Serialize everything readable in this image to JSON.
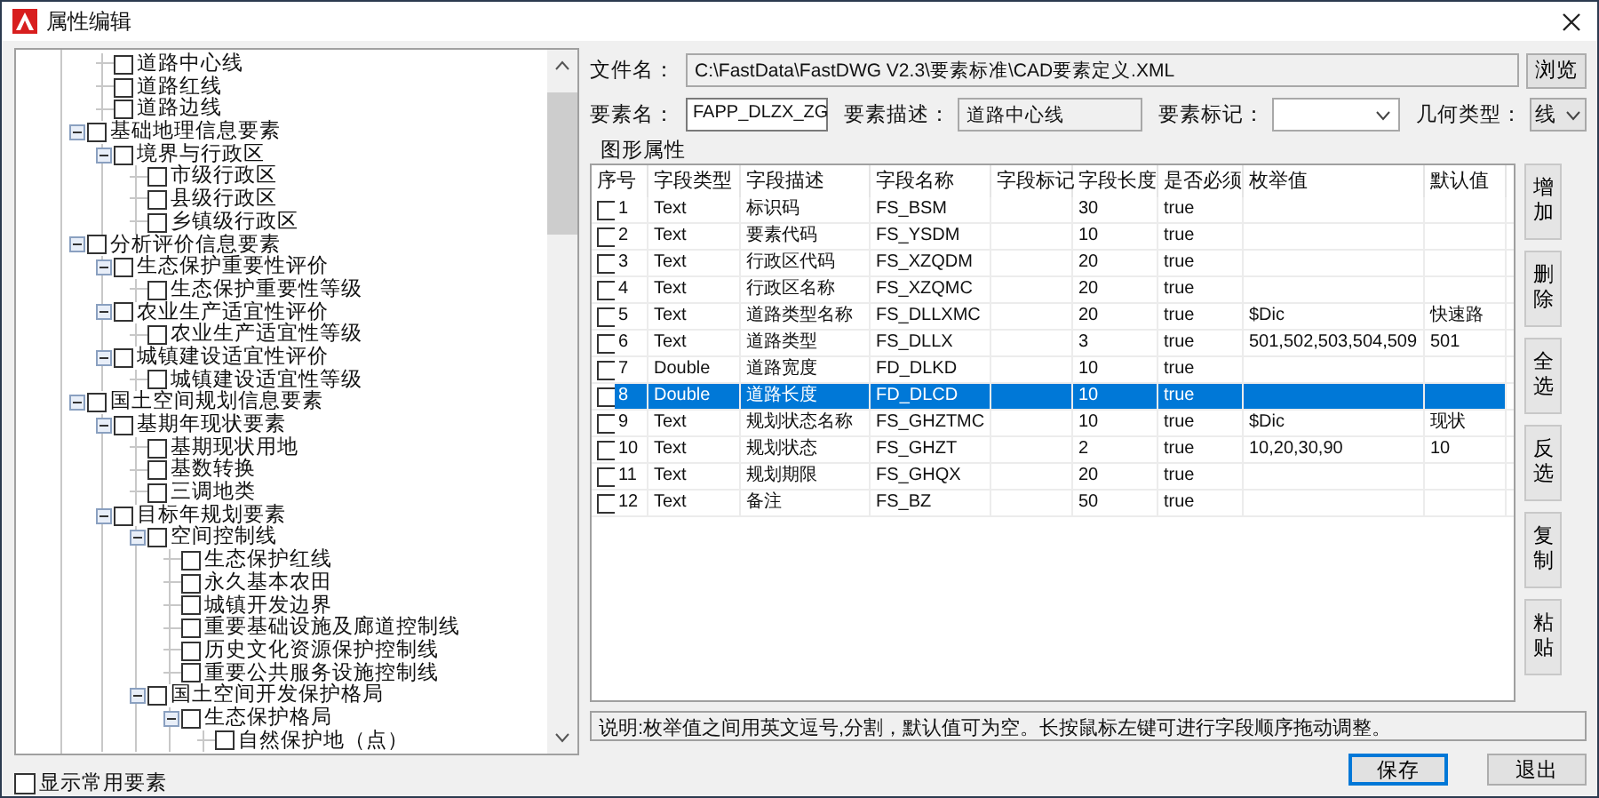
{
  "window": {
    "title": "属性编辑"
  },
  "tree": {
    "items": [
      {
        "children": [
          {
            "label": "道路中心线",
            "checked": false
          },
          {
            "label": "道路红线",
            "checked": false
          },
          {
            "label": "道路边线",
            "checked": false
          }
        ]
      },
      {
        "label": "基础地理信息要素",
        "checked": false,
        "expanded": true,
        "children": [
          {
            "label": "境界与行政区",
            "checked": false,
            "expanded": true,
            "children": [
              {
                "label": "市级行政区",
                "checked": false
              },
              {
                "label": "县级行政区",
                "checked": false
              },
              {
                "label": "乡镇级行政区",
                "checked": false
              }
            ]
          }
        ]
      },
      {
        "label": "分析评价信息要素",
        "checked": false,
        "expanded": true,
        "children": [
          {
            "label": "生态保护重要性评价",
            "checked": false,
            "expanded": true,
            "children": [
              {
                "label": "生态保护重要性等级",
                "checked": false
              }
            ]
          },
          {
            "label": "农业生产适宜性评价",
            "checked": false,
            "expanded": true,
            "children": [
              {
                "label": "农业生产适宜性等级",
                "checked": false
              }
            ]
          },
          {
            "label": "城镇建设适宜性评价",
            "checked": false,
            "expanded": true,
            "children": [
              {
                "label": "城镇建设适宜性等级",
                "checked": false
              }
            ]
          }
        ]
      },
      {
        "label": "国土空间规划信息要素",
        "checked": false,
        "expanded": true,
        "children": [
          {
            "label": "基期年现状要素",
            "checked": false,
            "expanded": true,
            "children": [
              {
                "label": "基期现状用地",
                "checked": false
              },
              {
                "label": "基数转换",
                "checked": false
              },
              {
                "label": "三调地类",
                "checked": false
              }
            ]
          },
          {
            "label": "目标年规划要素",
            "checked": false,
            "expanded": true,
            "children": [
              {
                "label": "空间控制线",
                "checked": false,
                "expanded": true,
                "children": [
                  {
                    "label": "生态保护红线",
                    "checked": false
                  },
                  {
                    "label": "永久基本农田",
                    "checked": false
                  },
                  {
                    "label": "城镇开发边界",
                    "checked": false
                  },
                  {
                    "label": "重要基础设施及廊道控制线",
                    "checked": false
                  },
                  {
                    "label": "历史文化资源保护控制线",
                    "checked": false
                  },
                  {
                    "label": "重要公共服务设施控制线",
                    "checked": false
                  }
                ]
              },
              {
                "label": "国土空间开发保护格局",
                "checked": false,
                "expanded": true,
                "children": [
                  {
                    "label": "生态保护格局",
                    "checked": false,
                    "expanded": true,
                    "children": [
                      {
                        "label": "自然保护地（点）",
                        "checked": false
                      }
                    ]
                  }
                ]
              }
            ]
          }
        ]
      }
    ]
  },
  "show_common": {
    "label": "显示常用要素",
    "checked": false
  },
  "file": {
    "label": "文件名：",
    "value": "C:\\FastData\\FastDWG V2.3\\要素标准\\CAD要素定义.XML",
    "button": "浏览"
  },
  "element": {
    "name_label": "要素名：",
    "name_value": "FAPP_DLZX_ZG",
    "desc_label": "要素描述：",
    "desc_value": "道路中心线",
    "mark_label": "要素标记：",
    "geom_label": "几何类型：",
    "geom_value": "线"
  },
  "group_title": "图形属性",
  "table": {
    "columns": [
      "序号",
      "字段类型",
      "字段描述",
      "字段名称",
      "字段标记",
      "字段长度",
      "是否必须",
      "枚举值",
      "默认值"
    ],
    "rows": [
      {
        "no": "1",
        "type": "Text",
        "description": "标识码",
        "name": "FS_BSM",
        "length": "30",
        "required": "true",
        "checked": false,
        "selected": false
      },
      {
        "no": "2",
        "type": "Text",
        "description": "要素代码",
        "name": "FS_YSDM",
        "length": "10",
        "required": "true",
        "checked": false,
        "selected": false
      },
      {
        "no": "3",
        "type": "Text",
        "description": "行政区代码",
        "name": "FS_XZQDM",
        "length": "20",
        "required": "true",
        "checked": false,
        "selected": false
      },
      {
        "no": "4",
        "type": "Text",
        "description": "行政区名称",
        "name": "FS_XZQMC",
        "length": "20",
        "required": "true",
        "checked": false,
        "selected": false
      },
      {
        "no": "5",
        "type": "Text",
        "description": "道路类型名称",
        "name": "FS_DLLXMC",
        "length": "20",
        "required": "true",
        "enum": "$Dic",
        "default": "快速路",
        "checked": false,
        "selected": false
      },
      {
        "no": "6",
        "type": "Text",
        "description": "道路类型",
        "name": "FS_DLLX",
        "length": "3",
        "required": "true",
        "enum": "501,502,503,504,509",
        "default": "501",
        "checked": false,
        "selected": false
      },
      {
        "no": "7",
        "type": "Double",
        "description": "道路宽度",
        "name": "FD_DLKD",
        "length": "10",
        "required": "true",
        "checked": false,
        "selected": false
      },
      {
        "no": "8",
        "type": "Double",
        "description": "道路长度",
        "name": "FD_DLCD",
        "length": "10",
        "required": "true",
        "checked": false,
        "selected": true
      },
      {
        "no": "9",
        "type": "Text",
        "description": "规划状态名称",
        "name": "FS_GHZTMC",
        "length": "10",
        "required": "true",
        "enum": "$Dic",
        "default": "现状",
        "checked": false,
        "selected": false
      },
      {
        "no": "10",
        "type": "Text",
        "description": "规划状态",
        "name": "FS_GHZT",
        "length": "2",
        "required": "true",
        "enum": "10,20,30,90",
        "default": "10",
        "checked": false,
        "selected": false
      },
      {
        "no": "11",
        "type": "Text",
        "description": "规划期限",
        "name": "FS_GHQX",
        "length": "20",
        "required": "true",
        "checked": false,
        "selected": false
      },
      {
        "no": "12",
        "type": "Text",
        "description": "备注",
        "name": "FS_BZ",
        "length": "50",
        "required": "true",
        "checked": false,
        "selected": false
      }
    ]
  },
  "side_buttons": [
    "增加",
    "删除",
    "全选",
    "反选",
    "复制",
    "粘贴"
  ],
  "note": "说明:枚举值之间用英文逗号,分割，默认值可为空。长按鼠标左键可进行字段顺序拖动调整。",
  "buttons": [
    {
      "label": "保存",
      "kind": "default"
    },
    {
      "label": "退出",
      "kind": "normal"
    }
  ]
}
